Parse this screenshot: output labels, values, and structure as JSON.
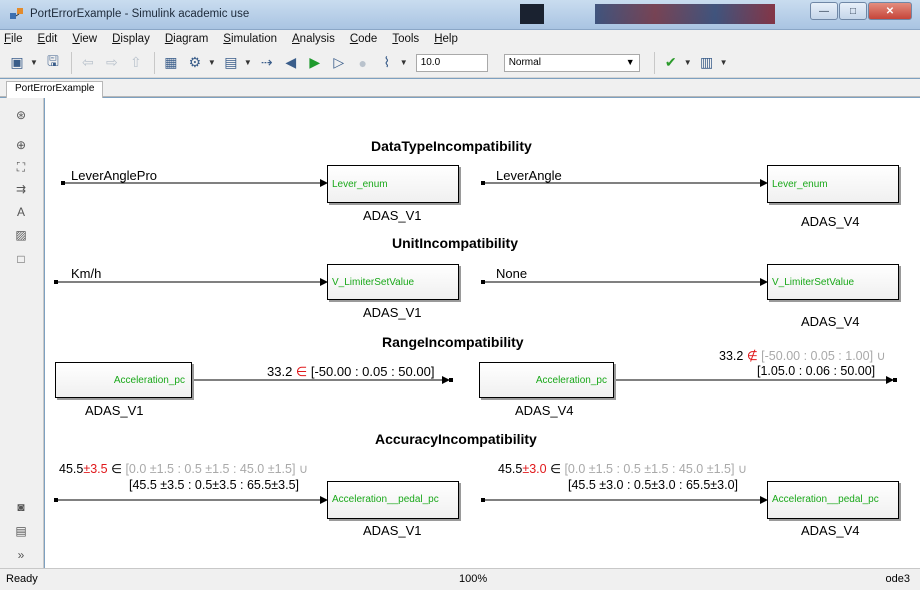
{
  "window": {
    "title": "PortErrorExample - Simulink academic use",
    "minimize": "—",
    "maximize": "□",
    "close": "✕"
  },
  "menu": [
    {
      "label": "File",
      "u": "F",
      "rest": "ile"
    },
    {
      "label": "Edit",
      "u": "E",
      "rest": "dit"
    },
    {
      "label": "View",
      "u": "V",
      "rest": "iew"
    },
    {
      "label": "Display",
      "u": "D",
      "rest": "isplay"
    },
    {
      "label": "Diagram",
      "u": "D",
      "rest": "iagram"
    },
    {
      "label": "Simulation",
      "u": "S",
      "rest": "imulation"
    },
    {
      "label": "Analysis",
      "u": "A",
      "rest": "nalysis"
    },
    {
      "label": "Code",
      "u": "C",
      "rest": "ode"
    },
    {
      "label": "Tools",
      "u": "T",
      "rest": "ools"
    },
    {
      "label": "Help",
      "u": "H",
      "rest": "elp"
    }
  ],
  "toolbar": {
    "stop_time": "10.0",
    "sim_mode": "Normal"
  },
  "tab": "PortErrorExample",
  "status": {
    "left": "Ready",
    "zoom": "100%",
    "solver": "ode3"
  },
  "diagram": {
    "sections": {
      "datatype": "DataTypeIncompatibility",
      "unit": "UnitIncompatibility",
      "range": "RangeIncompatibility",
      "accuracy": "AccuracyIncompatibility"
    },
    "datatype": {
      "sig1": "LeverAnglePro",
      "sig2": "LeverAngle",
      "port1": "Lever_enum",
      "port2": "Lever_enum",
      "name1": "ADAS_V1",
      "name2": "ADAS_V4"
    },
    "unit": {
      "sig1": "Km/h",
      "sig2": "None",
      "port1": "V_LimiterSetValue",
      "port2": "V_LimiterSetValue",
      "name1": "ADAS_V1",
      "name2": "ADAS_V4"
    },
    "range": {
      "port1": "Acceleration_pc",
      "port2": "Acceleration_pc",
      "name1": "ADAS_V1",
      "name2": "ADAS_V4",
      "sig1_val": "33.2 ",
      "sig1_sym": "∈",
      "sig1_rng": " [-50.00 : 0.05 : 50.00]",
      "sig2_val": "33.2 ",
      "sig2_sym": "∉",
      "sig2_rng": " [-50.00 : 0.05 : 1.00] ∪",
      "sig2_rng2": "[1.05.0 : 0.06 : 50.00]"
    },
    "accuracy": {
      "port1": "Acceleration__pedal_pc",
      "port2": "Acceleration__pedal_pc",
      "name1": "ADAS_V1",
      "name2": "ADAS_V4",
      "sig1_val": "45.5",
      "sig1_acc": "±3.5",
      "sig1_in": " ∈ ",
      "sig1_rng": "[0.0 ±1.5 : 0.5 ±1.5 : 45.0 ±1.5] ∪",
      "sig1_rng2": "[45.5 ±3.5 : 0.5±3.5 : 65.5±3.5]",
      "sig2_val": "45.5",
      "sig2_acc": "±3.0",
      "sig2_in": " ∈ ",
      "sig2_rng": "[0.0 ±1.5 : 0.5 ±1.5 : 45.0 ±1.5] ∪",
      "sig2_rng2": "[45.5 ±3.0 : 0.5±3.0 : 65.5±3.0]"
    }
  }
}
